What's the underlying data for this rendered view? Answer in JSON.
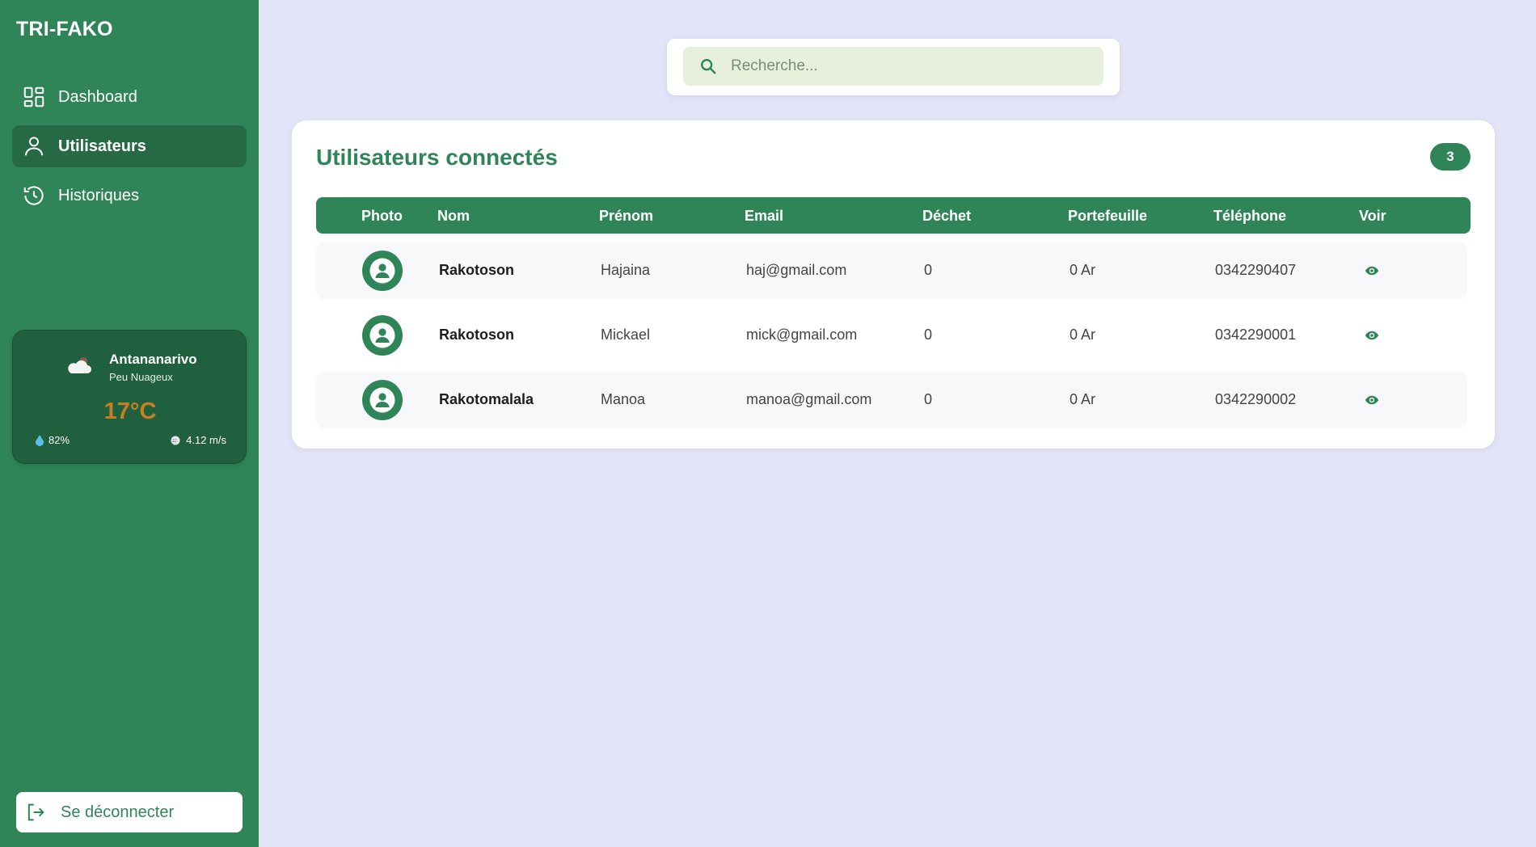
{
  "app": {
    "title": "TRI-FAKO"
  },
  "sidebar": {
    "items": [
      {
        "label": "Dashboard",
        "icon": "dashboard-icon",
        "active": false
      },
      {
        "label": "Utilisateurs",
        "icon": "user-icon",
        "active": true
      },
      {
        "label": "Historiques",
        "icon": "history-icon",
        "active": false
      }
    ],
    "logout_label": "Se déconnecter"
  },
  "weather": {
    "city": "Antananarivo",
    "description": "Peu Nuageux",
    "temperature": "17°C",
    "humidity": "82%",
    "wind": "4.12 m/s"
  },
  "search": {
    "placeholder": "Recherche..."
  },
  "users_card": {
    "title": "Utilisateurs connectés",
    "count": "3",
    "columns": [
      "Photo",
      "Nom",
      "Prénom",
      "Email",
      "Déchet",
      "Portefeuille",
      "Téléphone",
      "Voir"
    ],
    "rows": [
      {
        "nom": "Rakotoson",
        "prenom": "Hajaina",
        "email": "haj@gmail.com",
        "dechet": "0",
        "portefeuille": "0 Ar",
        "telephone": "0342290407"
      },
      {
        "nom": "Rakotoson",
        "prenom": "Mickael",
        "email": "mick@gmail.com",
        "dechet": "0",
        "portefeuille": "0 Ar",
        "telephone": "0342290001"
      },
      {
        "nom": "Rakotomalala",
        "prenom": "Manoa",
        "email": "manoa@gmail.com",
        "dechet": "0",
        "portefeuille": "0 Ar",
        "telephone": "0342290002"
      }
    ]
  },
  "colors": {
    "primary": "#2f8557",
    "sidebar_active": "#256a45",
    "background": "#e4e4f8",
    "search_bg": "#e6f0db",
    "temperature": "#c67f22"
  }
}
